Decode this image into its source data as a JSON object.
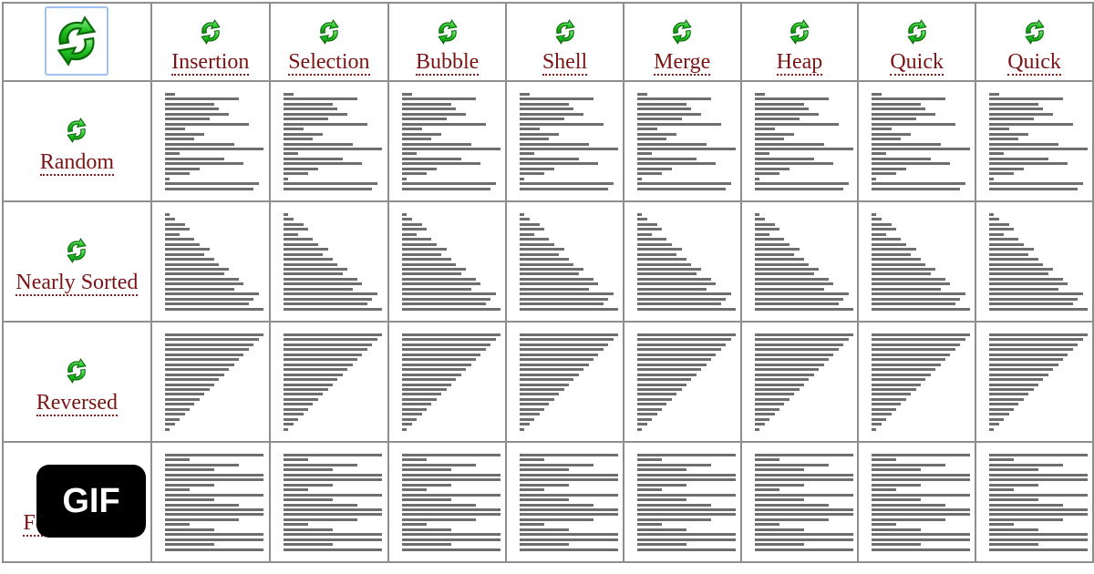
{
  "corner": {
    "icon": "refresh-arrows-icon"
  },
  "algorithms": [
    {
      "label": "Insertion",
      "icon": "refresh-arrows-icon"
    },
    {
      "label": "Selection",
      "icon": "refresh-arrows-icon"
    },
    {
      "label": "Bubble",
      "icon": "refresh-arrows-icon"
    },
    {
      "label": "Shell",
      "icon": "refresh-arrows-icon"
    },
    {
      "label": "Merge",
      "icon": "refresh-arrows-icon"
    },
    {
      "label": "Heap",
      "icon": "refresh-arrows-icon"
    },
    {
      "label": "Quick",
      "icon": "refresh-arrows-icon"
    },
    {
      "label": "Quick",
      "icon": "refresh-arrows-icon"
    }
  ],
  "conditions": [
    {
      "label": "Random",
      "icon": "refresh-arrows-icon",
      "max": 20,
      "values": [
        2,
        15,
        10,
        11,
        13,
        9,
        17,
        4,
        8,
        6,
        14,
        20,
        3,
        12,
        16,
        7,
        5,
        1,
        19,
        18
      ]
    },
    {
      "label": "Nearly Sorted",
      "icon": "refresh-arrows-icon",
      "max": 20,
      "values": [
        1,
        2,
        4,
        5,
        3,
        6,
        7,
        9,
        8,
        10,
        11,
        13,
        12,
        15,
        16,
        14,
        19,
        18,
        17,
        20
      ]
    },
    {
      "label": "Reversed",
      "icon": "refresh-arrows-icon",
      "max": 20,
      "values": [
        20,
        19,
        18,
        17,
        16,
        15,
        14,
        13,
        12,
        11,
        10,
        9,
        8,
        7,
        6,
        5,
        4,
        3,
        2,
        1
      ]
    },
    {
      "label": "Few Unique",
      "icon": "refresh-arrows-icon",
      "max": 4,
      "values": [
        4,
        1,
        3,
        2,
        4,
        4,
        2,
        1,
        4,
        2,
        3,
        4,
        4,
        3,
        1,
        2,
        4,
        4,
        2,
        4
      ]
    }
  ],
  "overlay": {
    "badge_label": "GIF"
  },
  "colors": {
    "label": "#7a1414",
    "bar": "#6e6e6e",
    "grid": "#8e8e8e",
    "icon_green": "#22c022"
  }
}
